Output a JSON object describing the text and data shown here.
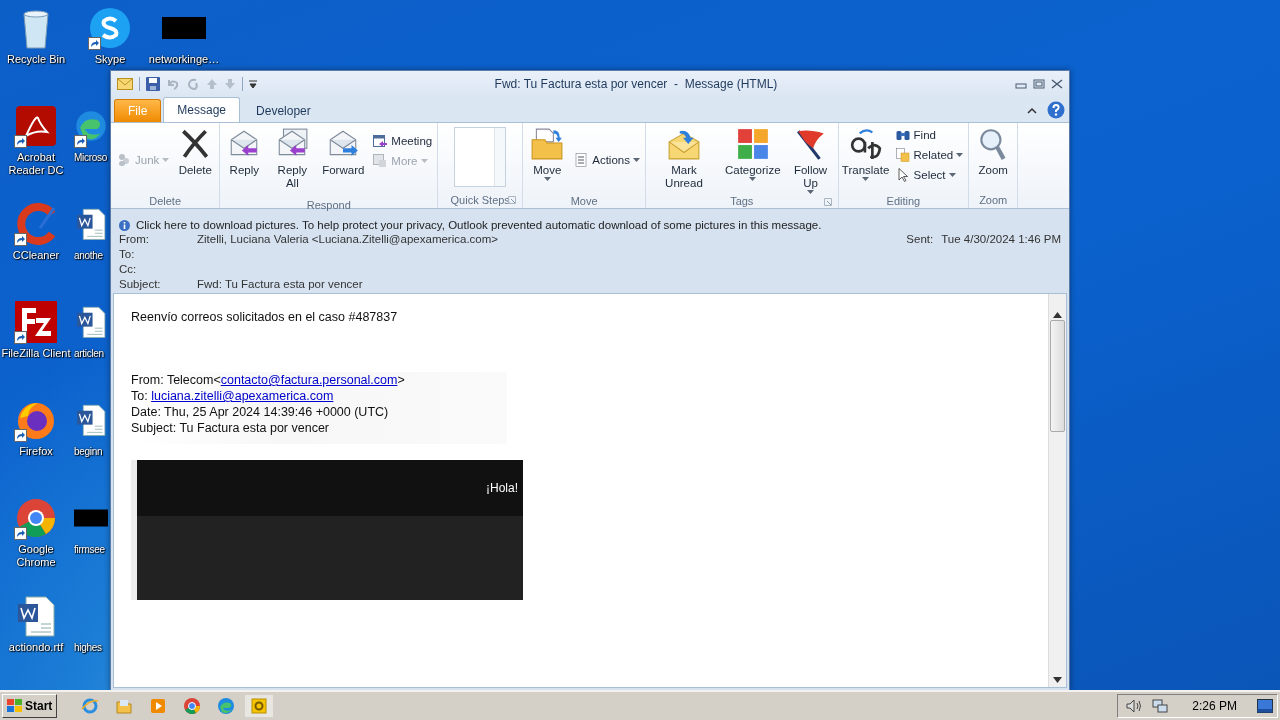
{
  "desktop": {
    "columns": [
      [
        {
          "label": "Recycle Bin",
          "kind": "recycle",
          "shortcut": false
        },
        {
          "label": "Acrobat Reader DC",
          "kind": "pdf",
          "shortcut": true
        },
        {
          "label": "CCleaner",
          "kind": "ccleaner",
          "shortcut": true
        },
        {
          "label": "FileZilla Client",
          "kind": "filezilla",
          "shortcut": true
        },
        {
          "label": "Firefox",
          "kind": "firefox",
          "shortcut": true
        },
        {
          "label": "Google Chrome",
          "kind": "chrome",
          "shortcut": true
        },
        {
          "label": "actiondo.rtf",
          "kind": "word",
          "shortcut": false
        }
      ],
      [
        {
          "label": "Skype",
          "kind": "skype",
          "shortcut": true
        },
        {
          "label": "Microso",
          "kind": "edge",
          "shortcut": true
        },
        {
          "label": "anothe",
          "kind": "word",
          "shortcut": false
        },
        {
          "label": "articlen",
          "kind": "word",
          "shortcut": false
        },
        {
          "label": "beginn",
          "kind": "word",
          "shortcut": false
        },
        {
          "label": "firmsee",
          "kind": "blank",
          "shortcut": false
        },
        {
          "label": "highes",
          "kind": "none"
        }
      ],
      [
        {
          "label": "networkinge…",
          "kind": "blank",
          "shortcut": false
        }
      ]
    ]
  },
  "window": {
    "title": "Fwd: Tu Factura esta por vencer  -  Message (HTML)",
    "tabs": [
      {
        "label": "File",
        "kind": "file",
        "selected": false
      },
      {
        "label": "Message",
        "kind": "tab",
        "selected": true
      },
      {
        "label": "Developer",
        "kind": "tab",
        "selected": false
      }
    ],
    "ribbon": [
      {
        "label": "Delete",
        "launcher": false,
        "items": [
          {
            "label": "Junk",
            "kind": "small",
            "disabled": true,
            "dropdown": true
          },
          {
            "label": "Delete",
            "kind": "large",
            "disabled": false,
            "dropdown": false
          }
        ]
      },
      {
        "label": "Respond",
        "launcher": false,
        "items": [
          {
            "label": "Reply",
            "kind": "large",
            "disabled": false,
            "dropdown": false
          },
          {
            "label": "Reply All",
            "kind": "large",
            "disabled": false,
            "dropdown": false
          },
          {
            "label": "Forward",
            "kind": "large",
            "disabled": false,
            "dropdown": false
          },
          {
            "label": "Meeting",
            "kind": "small",
            "disabled": false,
            "dropdown": false
          },
          {
            "label": "More",
            "kind": "small",
            "disabled": true,
            "dropdown": true
          }
        ]
      },
      {
        "label": "Quick Steps",
        "launcher": true,
        "items": [
          {
            "kind": "gallery"
          }
        ]
      },
      {
        "label": "Move",
        "launcher": false,
        "items": [
          {
            "label": "Move",
            "kind": "large",
            "disabled": false,
            "dropdown": true
          },
          {
            "label": "Actions",
            "kind": "small",
            "disabled": false,
            "dropdown": true
          }
        ]
      },
      {
        "label": "Tags",
        "launcher": true,
        "items": [
          {
            "label": "Mark Unread",
            "kind": "large",
            "disabled": false,
            "dropdown": false
          },
          {
            "label": "Categorize",
            "kind": "large",
            "disabled": false,
            "dropdown": true
          },
          {
            "label": "Follow Up",
            "kind": "large",
            "disabled": false,
            "dropdown": true
          }
        ]
      },
      {
        "label": "Editing",
        "launcher": false,
        "items": [
          {
            "label": "Translate",
            "kind": "large",
            "disabled": false,
            "dropdown": true
          },
          {
            "label": "Find",
            "kind": "small",
            "disabled": false,
            "dropdown": false
          },
          {
            "label": "Related",
            "kind": "small",
            "disabled": false,
            "dropdown": true
          },
          {
            "label": "Select",
            "kind": "small",
            "disabled": false,
            "dropdown": true
          }
        ]
      },
      {
        "label": "Zoom",
        "launcher": false,
        "items": [
          {
            "label": "Zoom",
            "kind": "large",
            "disabled": false,
            "dropdown": false
          }
        ]
      }
    ],
    "info_bar": "Click here to download pictures. To help protect your privacy, Outlook prevented automatic download of some pictures in this message.",
    "headers": [
      {
        "label": "From:",
        "value": "Zitelli, Luciana Valeria <Luciana.Zitelli@apexamerica.com>"
      },
      {
        "label": "To:"
      },
      {
        "label": "Cc:"
      },
      {
        "label": "Subject:",
        "value": "Fwd: Tu Factura esta por vencer"
      }
    ],
    "sent": {
      "label": "Sent:",
      "value": "Tue 4/30/2024 1:46 PM"
    },
    "body": {
      "intro": "Reenvío correos solicitados en el caso #487837",
      "forwarded": [
        {
          "text": "From: Telecom<",
          "link": "contacto@factura.personal.com",
          "after": ">"
        },
        {
          "text": "To: ",
          "link": "luciana.zitelli@apexamerica.com"
        },
        {
          "text": "Date: Thu, 25 Apr 2024 14:39:46 +0000 (UTC)"
        },
        {
          "text": "Subject: Tu Factura esta por vencer"
        }
      ],
      "banner": {
        "greeting": "¡Hola!"
      }
    }
  },
  "taskbar": {
    "start": "Start",
    "apps": [
      {
        "kind": "ie",
        "active": false
      },
      {
        "kind": "explorer",
        "active": false
      },
      {
        "kind": "media",
        "active": false
      },
      {
        "kind": "chrome",
        "active": false
      },
      {
        "kind": "edge",
        "active": false
      },
      {
        "kind": "outlook",
        "active": true
      }
    ],
    "clock": "2:26 PM"
  }
}
